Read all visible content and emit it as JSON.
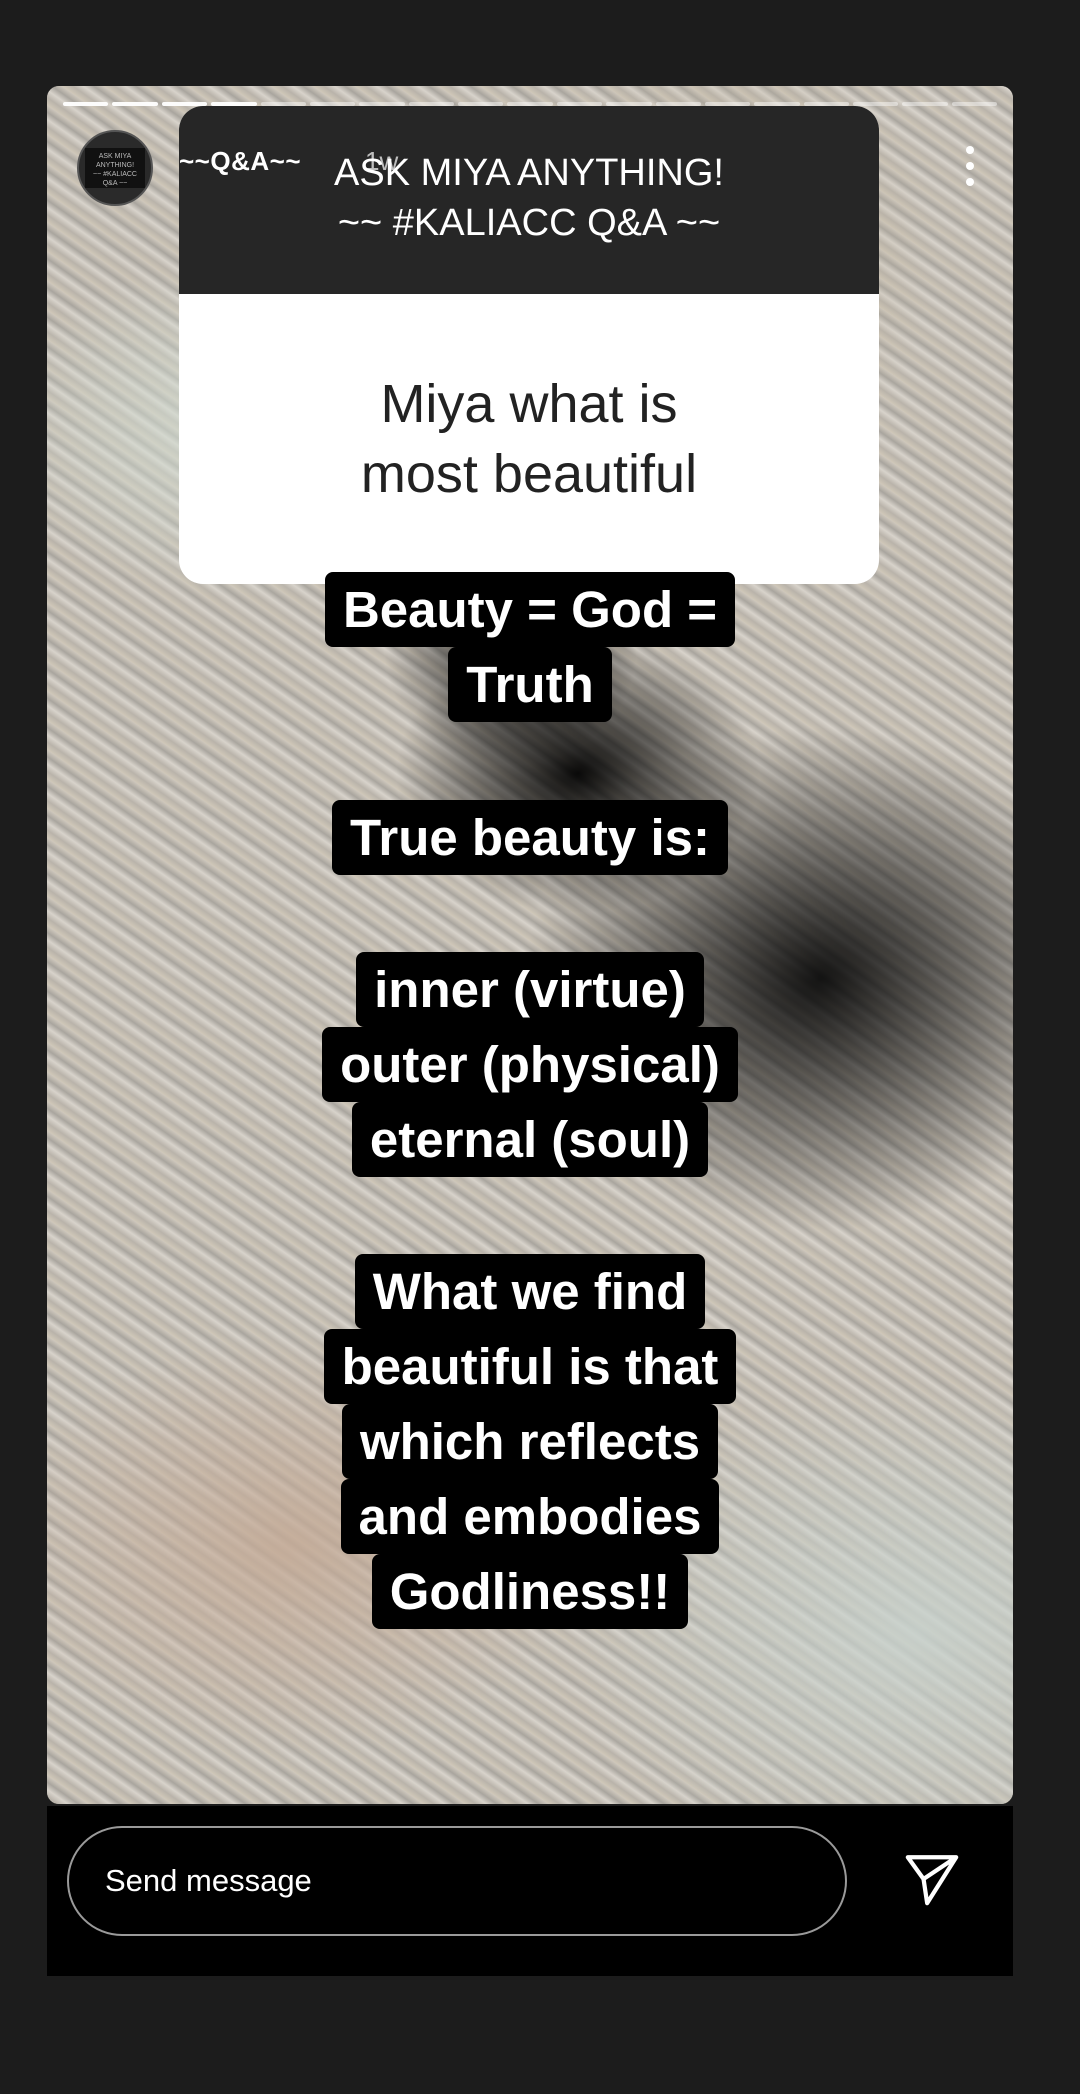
{
  "story": {
    "username": "~~Q&A~~",
    "age": "1w",
    "avatar_text": "ASK MIYA ANYTHING! ~~ #KALIACC Q&A ~~",
    "progress_total": 19,
    "progress_done": 4
  },
  "qa_card": {
    "header_line1": "ASK MIYA ANYTHING!",
    "header_line2": "~~ #KALIACC Q&A ~~",
    "question_line1": "Miya what is",
    "question_line2": "most beautiful"
  },
  "text_blocks": [
    [
      "Beauty = God =",
      "Truth"
    ],
    [
      "True beauty is:"
    ],
    [
      "inner (virtue)",
      "outer (physical)",
      "eternal (soul)"
    ],
    [
      "What we find",
      "beautiful is that",
      "which reflects",
      "and embodies",
      "Godliness!!"
    ]
  ],
  "bottom_bar": {
    "message_placeholder": "Send message"
  },
  "icons": {
    "more": "more-vertical-icon",
    "send": "send-paper-plane-icon"
  }
}
